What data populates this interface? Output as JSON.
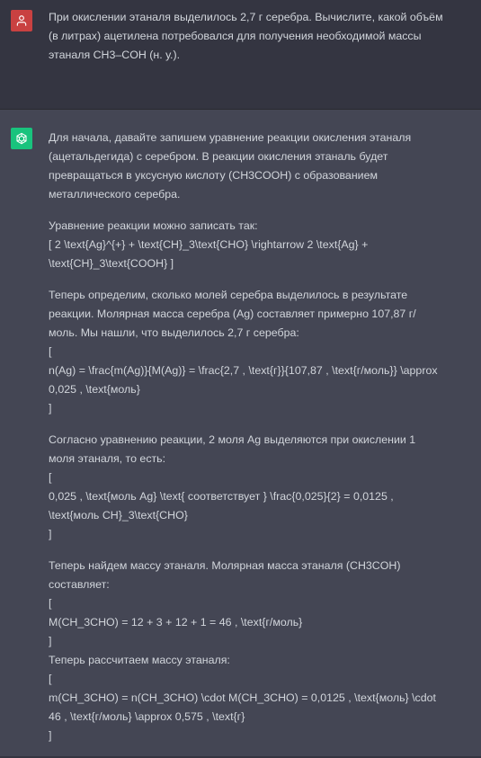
{
  "user_message": {
    "lines": [
      "При окислении этаналя выделилось 2,7 г серебра. Вычислите, какой объём",
      "(в литрах) ацетилена потребовался для получения необходимой массы",
      "этаналя CH3–COH (н. у.)."
    ]
  },
  "assistant_message": {
    "blocks": [
      [
        "Для начала, давайте запишем уравнение реакции окисления этаналя",
        "(ацетальдегида) с серебром. В реакции окисления этаналь будет",
        "превращаться в уксусную кислоту (CH3COOH) с образованием",
        "металлического серебра."
      ],
      [
        "Уравнение реакции можно записать так:",
        "[ 2 \\text{Ag}^{+} + \\text{CH}_3\\text{CHO} \\rightarrow 2 \\text{Ag} +",
        "\\text{CH}_3\\text{COOH} ]"
      ],
      [
        "Теперь определим, сколько молей серебра выделилось в результате",
        "реакции. Молярная масса серебра (Ag) составляет примерно 107,87 г/",
        "моль. Мы нашли, что выделилось 2,7 г серебра:",
        "[",
        "n(Ag) = \\frac{m(Ag)}{M(Ag)} = \\frac{2,7 , \\text{г}}{107,87 , \\text{г/моль}} \\approx",
        "0,025 , \\text{моль}",
        "]"
      ],
      [
        "Согласно уравнению реакции, 2 моля Ag выделяются при окислении 1",
        "моля этаналя, то есть:",
        "[",
        "0,025 , \\text{моль Ag} \\text{ соответствует } \\frac{0,025}{2} = 0,0125 ,",
        "\\text{моль CH}_3\\text{CHO}",
        "]"
      ],
      [
        "Теперь найдем массу этаналя. Молярная масса этаналя (CH3COH)",
        "составляет:",
        "[",
        "M(CH_3CHO) = 12 + 3 + 12 + 1 = 46 , \\text{г/моль}",
        "]",
        "Теперь рассчитаем массу этаналя:",
        "[",
        "m(CH_3CHO) = n(CH_3CHO) \\cdot M(CH_3CHO) = 0,0125 , \\text{моль} \\cdot",
        "46 , \\text{г/моль} \\approx 0,575 , \\text{г}",
        "]"
      ]
    ]
  },
  "icons": {
    "user_avatar": "user-icon",
    "assistant_avatar": "openai-logo-icon"
  },
  "colors": {
    "background": "#343541",
    "assistant_background": "#444654",
    "user_avatar": "#c94141",
    "assistant_avatar": "#19c37d",
    "text": "#d1d5db"
  }
}
